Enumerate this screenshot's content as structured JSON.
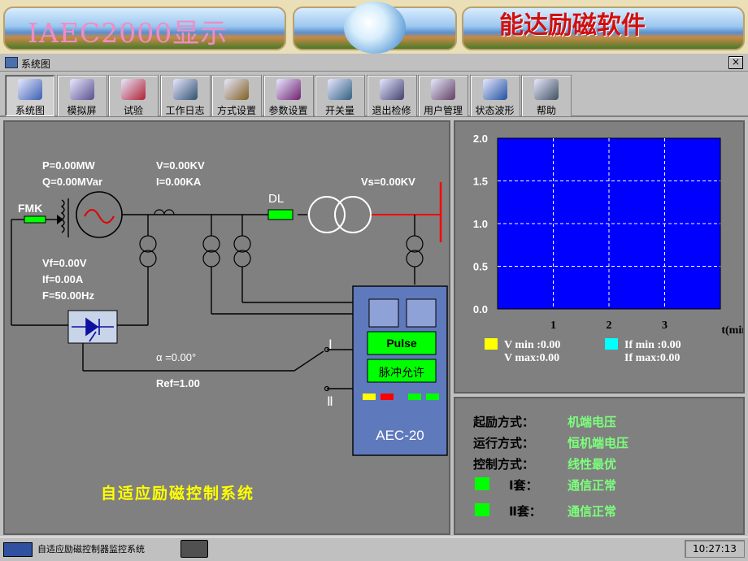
{
  "banner": {
    "title": "IAEC2000显示",
    "brand": "能达励磁软件"
  },
  "window": {
    "title": "系统图",
    "close": "×"
  },
  "toolbar": {
    "items": [
      {
        "label": "系统图",
        "icon": "system-diagram-icon",
        "active": true
      },
      {
        "label": "模拟屏",
        "icon": "simulation-screen-icon"
      },
      {
        "label": "试验",
        "icon": "test-pen-icon"
      },
      {
        "label": "工作日志",
        "icon": "work-log-icon"
      },
      {
        "label": "方式设置",
        "icon": "mode-settings-icon"
      },
      {
        "label": "参数设置",
        "icon": "parameter-settings-icon"
      },
      {
        "label": "开关量",
        "icon": "switch-io-icon"
      },
      {
        "label": "退出检修",
        "icon": "exit-maintenance-icon"
      },
      {
        "label": "用户管理",
        "icon": "user-management-icon"
      },
      {
        "label": "状态波形",
        "icon": "status-waveform-icon"
      },
      {
        "label": "帮助",
        "icon": "help-icon"
      }
    ]
  },
  "diagram": {
    "P": "P=0.00MW",
    "Q": "Q=0.00MVar",
    "V": "V=0.00KV",
    "I": "I=0.00KA",
    "Vs": "Vs=0.00KV",
    "fmk": "FMK",
    "dl": "DL",
    "vf": "Vf=0.00V",
    "if": "If=0.00A",
    "f": "F=50.00Hz",
    "alpha": "α =0.00°",
    "ref": "Ref=1.00",
    "channel1": "Ⅰ",
    "channel2": "Ⅱ",
    "pulse": "Pulse",
    "pulse_enable": "脉冲允许",
    "device": "AEC-20",
    "system_name": "自适应励磁控制系统",
    "colors": {
      "green": "#00ff00",
      "red": "#ff0000",
      "yellow": "#ffff00",
      "device_bg": "#5f79bd"
    }
  },
  "chart_data": {
    "type": "line",
    "x": [],
    "series": [],
    "xticks": [
      "1",
      "2",
      "3"
    ],
    "yticks": [
      "2.0",
      "1.5",
      "1.0",
      "0.5",
      "0.0"
    ],
    "xunit": "t(min)",
    "xlim": [
      0,
      4
    ],
    "ylim": [
      0,
      2.0
    ],
    "grid": true,
    "plot_bg": "#0000ff",
    "legend": [
      {
        "color": "#ffff00",
        "lines": [
          "V min :0.00",
          "V max:0.00"
        ]
      },
      {
        "color": "#00ffff",
        "lines": [
          "If min :0.00",
          "If max:0.00"
        ]
      }
    ]
  },
  "status": {
    "rows": [
      {
        "label": "起励方式：",
        "value": "机端电压"
      },
      {
        "label": "运行方式：",
        "value": "恒机端电压"
      },
      {
        "label": "控制方式：",
        "value": "线性最优"
      },
      {
        "label": "Ⅰ套：",
        "value": "通信正常",
        "indicator": "#00ff00"
      },
      {
        "label": "Ⅱ套：",
        "value": "通信正常",
        "indicator": "#00ff00"
      }
    ]
  },
  "statusbar": {
    "app_name": "自适应励磁控制器监控系统",
    "time": "10:27:13"
  }
}
